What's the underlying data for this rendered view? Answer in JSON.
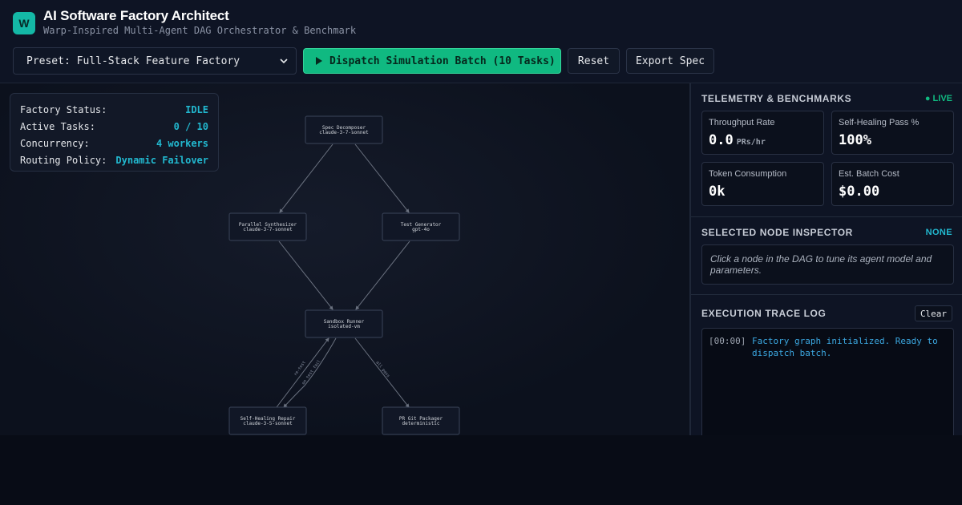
{
  "header": {
    "logo": "W",
    "title": "AI Software Factory Architect",
    "subtitle": "Warp-Inspired Multi-Agent DAG Orchestrator & Benchmark"
  },
  "toolbar": {
    "preset_value": "Preset: Full-Stack Feature Factory",
    "dispatch_label": "Dispatch Simulation Batch (10 Tasks)",
    "reset_label": "Reset",
    "export_label": "Export Spec"
  },
  "status": {
    "rows": [
      {
        "label": "Factory Status:",
        "value": "IDLE"
      },
      {
        "label": "Active Tasks:",
        "value": "0 / 10"
      },
      {
        "label": "Concurrency:",
        "value": "4 workers"
      },
      {
        "label": "Routing Policy:",
        "value": "Dynamic Failover"
      }
    ]
  },
  "dag": {
    "nodes": [
      {
        "name": "Spec Decomposer",
        "model": "claude-3-7-sonnet"
      },
      {
        "name": "Parallel Synthesizer",
        "model": "claude-3-7-sonnet"
      },
      {
        "name": "Test Generator",
        "model": "gpt-4o"
      },
      {
        "name": "Sandbox Runner",
        "model": "isolated-vm"
      },
      {
        "name": "Self-Healing Repair",
        "model": "claude-3-5-sonnet"
      },
      {
        "name": "PR Git Packager",
        "model": "deterministic"
      }
    ],
    "edge_labels": [
      "re-test",
      "on test fail",
      "all pass"
    ]
  },
  "telemetry": {
    "title": "TELEMETRY & BENCHMARKS",
    "live": "● LIVE",
    "throughput_label": "Throughput Rate",
    "throughput_value": "0.0",
    "throughput_unit": "PRs/hr",
    "healing_label": "Self-Healing Pass %",
    "healing_value": "100%",
    "tokens_label": "Token Consumption",
    "tokens_value": "0k",
    "cost_label": "Est. Batch Cost",
    "cost_value": "$0.00"
  },
  "inspector": {
    "title": "SELECTED NODE INSPECTOR",
    "selected": "NONE",
    "hint": "Click a node in the DAG to tune its agent model and parameters."
  },
  "trace": {
    "title": "EXECUTION TRACE LOG",
    "clear_label": "Clear",
    "entries": [
      {
        "time": "[00:00]",
        "message": "Factory graph initialized. Ready to dispatch batch."
      }
    ]
  },
  "colors": {
    "accent": "#10b981",
    "info": "#22b8cf",
    "log": "#3ba7e0"
  }
}
